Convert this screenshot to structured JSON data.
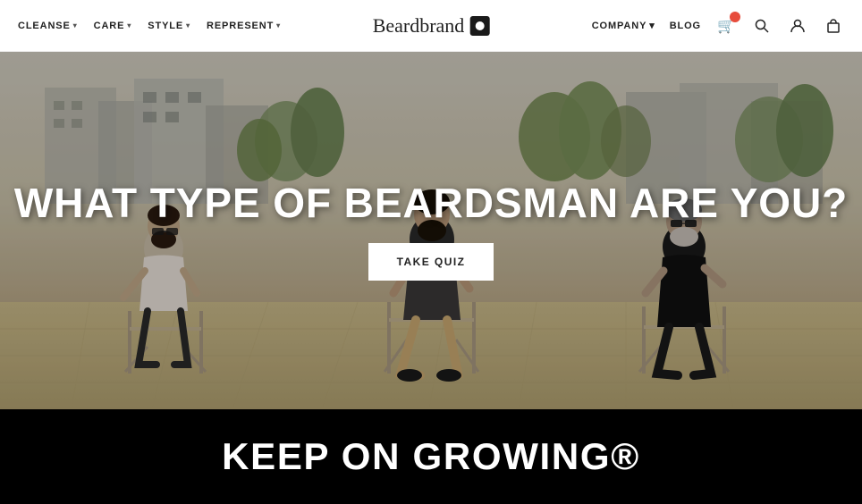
{
  "navbar": {
    "nav_left": [
      {
        "label": "CLEANSE",
        "has_dropdown": true
      },
      {
        "label": "CARE",
        "has_dropdown": true
      },
      {
        "label": "STYLE",
        "has_dropdown": true
      },
      {
        "label": "REPRESENT",
        "has_dropdown": true
      }
    ],
    "logo_text": "Beardbrand",
    "nav_right": [
      {
        "label": "COMPANY",
        "has_dropdown": true
      },
      {
        "label": "BLOG",
        "has_dropdown": false
      }
    ],
    "icons": {
      "cart": "🛒",
      "search": "🔍",
      "account": "👤",
      "bag": "🛍"
    }
  },
  "hero": {
    "title": "WHAT TYPE OF BEARDSMAN ARE YOU?",
    "quiz_button": "TAKE QUIZ"
  },
  "bottom_band": {
    "title": "KEEP ON GROWING®"
  }
}
